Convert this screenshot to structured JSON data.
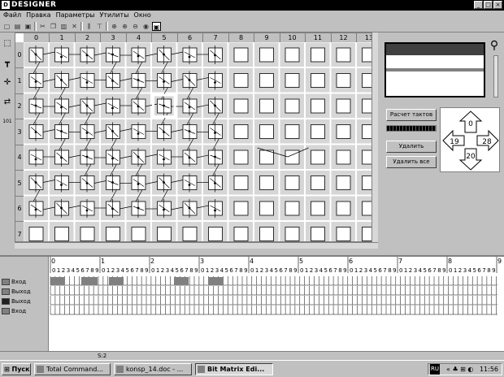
{
  "window": {
    "title": "DESIGNER",
    "logo_letter": "D"
  },
  "menu": [
    "Файл",
    "Правка",
    "Параметры",
    "Утилиты",
    "Окно"
  ],
  "toolbar_icons": [
    "new-icon",
    "open-icon",
    "save-icon",
    "cut-icon",
    "copy-icon",
    "paste-icon",
    "delete-icon",
    "insert-column-icon",
    "insert-row-icon",
    "zoom-fit-icon",
    "zoom-in-icon",
    "zoom-out-icon",
    "eye-icon",
    "mode-icon"
  ],
  "tools": [
    "select-tool",
    "pin-tool",
    "route-tool",
    "connect-tool",
    "label-tool"
  ],
  "tool_labels": {
    "label_tool": "101"
  },
  "grid": {
    "columns": [
      "0",
      "1",
      "2",
      "3",
      "4",
      "5",
      "6",
      "7",
      "8",
      "9",
      "10",
      "11",
      "12",
      "13"
    ],
    "rows": [
      "0",
      "1",
      "2",
      "3",
      "4",
      "5",
      "6",
      "7"
    ]
  },
  "right_panel": {
    "calc_button": "Расчет тактов",
    "delete_button": "Удалить",
    "delete_all_button": "Удалить все",
    "compass": {
      "top": "0",
      "left": "19",
      "right": "28",
      "bottom": "20"
    }
  },
  "timeline": {
    "major_ticks": [
      "0",
      "1",
      "2",
      "3",
      "4",
      "5",
      "6",
      "7",
      "8",
      "9"
    ],
    "minor_digits": "0123456789",
    "signals": [
      {
        "label": "Вход",
        "color": "#808080"
      },
      {
        "label": "Выход",
        "color": "#808080"
      },
      {
        "label": "Выход",
        "color": "#202020"
      },
      {
        "label": "Вход",
        "color": "#808080"
      }
    ]
  },
  "status": {
    "text": "S:2"
  },
  "taskbar": {
    "start": "Пуск",
    "tasks": [
      "Total Command...",
      "konsp_14.doc - ...",
      "Bit Matrix Edi..."
    ],
    "lang": "RU",
    "time": "11:56"
  }
}
